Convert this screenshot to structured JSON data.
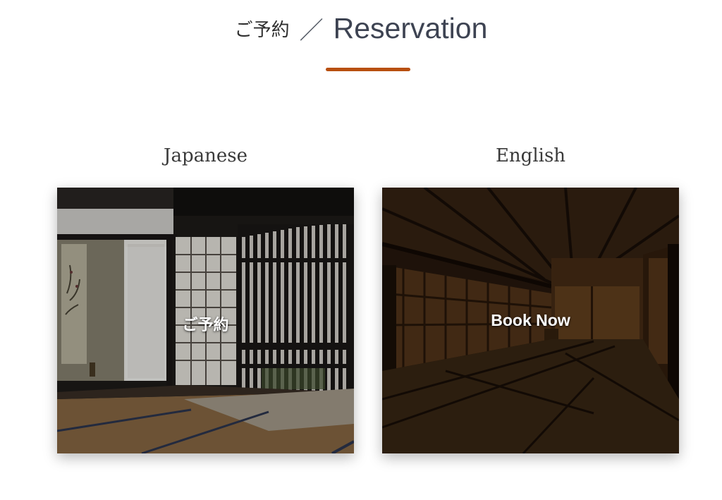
{
  "header": {
    "title_jp": "ご予約",
    "separator": "／",
    "title_en": "Reservation",
    "accent_color": "#b84f0f"
  },
  "columns": [
    {
      "title": "Japanese",
      "button_label": "ご予約",
      "image": "tatami-room-shoji-window-photo"
    },
    {
      "title": "English",
      "button_label": "Book Now",
      "image": "tatami-hall-dark-wood-photo"
    }
  ]
}
